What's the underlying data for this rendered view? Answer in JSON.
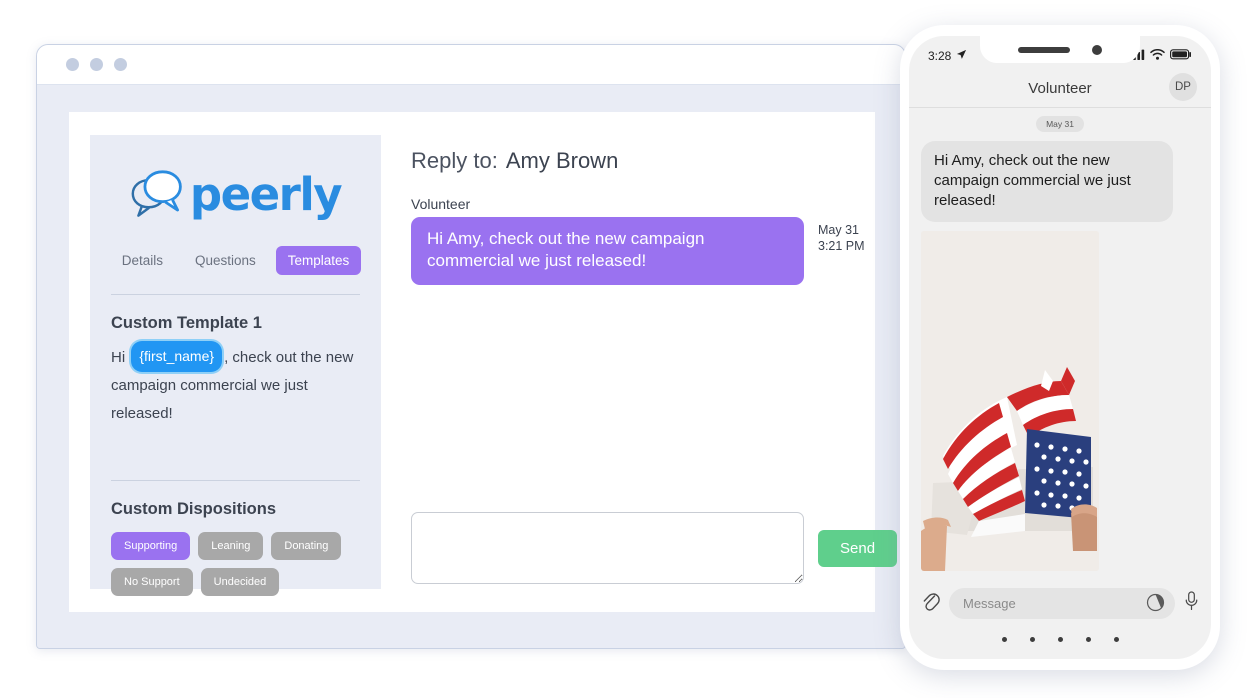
{
  "browser": {
    "window_dots": [
      "close",
      "minimize",
      "maximize"
    ],
    "dot_color": "#c3cde0"
  },
  "app": {
    "brand": {
      "word": "peerly",
      "color": "#2a8ce0",
      "mark_icon": "two-speech-bubbles-icon"
    },
    "tabs": [
      {
        "label": "Details",
        "active": false
      },
      {
        "label": "Questions",
        "active": false
      },
      {
        "label": "Templates",
        "active": true
      }
    ],
    "accent_purple": "#9a72f0",
    "template": {
      "heading": "Custom Template 1",
      "prefix": "Hi",
      "token": "{first_name}",
      "token_color": "#2196f3",
      "suffix": ", check out the new campaign commercial we just released!"
    },
    "dispositions": {
      "heading": "Custom Dispositions",
      "chips": [
        {
          "label": "Supporting",
          "selected": true
        },
        {
          "label": "Leaning",
          "selected": false
        },
        {
          "label": "Donating",
          "selected": false
        },
        {
          "label": "No Support",
          "selected": false
        },
        {
          "label": "Undecided",
          "selected": false
        }
      ]
    },
    "reply": {
      "title_prefix": "Reply to:",
      "recipient": "Amy Brown",
      "sender_label": "Volunteer",
      "message": "Hi Amy, check out the new campaign commercial we just released!",
      "stamp_date": "May 31",
      "stamp_time": "3:21 PM",
      "composer_value": "",
      "composer_placeholder": "",
      "send_label": "Send",
      "send_color": "#5fcf8c"
    }
  },
  "phone": {
    "status": {
      "time": "3:28",
      "location_icon": "location-arrow-icon",
      "signal_icon": "cellular-signal-icon",
      "wifi_icon": "wifi-icon",
      "battery_icon": "battery-full-icon"
    },
    "nav": {
      "title": "Volunteer",
      "avatar_initials": "DP"
    },
    "thread": {
      "date_pill": "May 31",
      "message": "Hi Amy, check out the new campaign commercial we just released!",
      "attachment_alt": "american-flag-photo"
    },
    "input": {
      "attach_icon": "paperclip-icon",
      "placeholder": "Message",
      "camera_icon": "camera-shutter-icon",
      "mic_icon": "microphone-icon",
      "home_dots": 5
    }
  }
}
